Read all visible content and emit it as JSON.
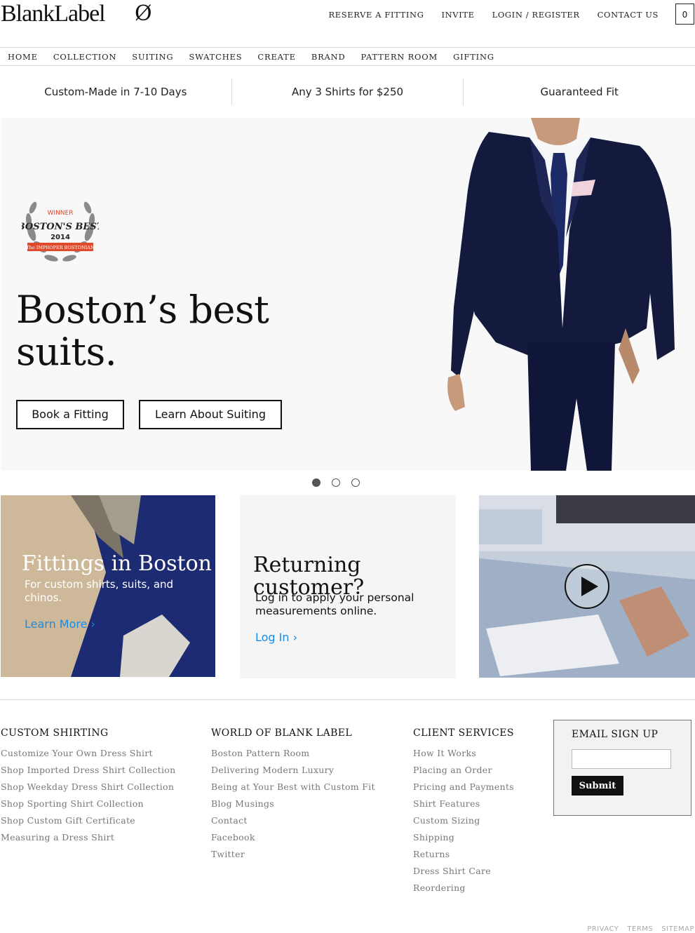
{
  "header": {
    "logo": "BlankLabel",
    "logo_mark": "Ø",
    "topnav": [
      "RESERVE A FITTING",
      "INVITE",
      "LOGIN / REGISTER",
      "CONTACT US"
    ],
    "cart_count": "0"
  },
  "mainnav": [
    "HOME",
    "COLLECTION",
    "SUITING",
    "SWATCHES",
    "CREATE",
    "BRAND",
    "PATTERN ROOM",
    "GIFTING"
  ],
  "props": [
    "Custom-Made in 7-10 Days",
    "Any 3 Shirts for $250",
    "Guaranteed Fit"
  ],
  "hero": {
    "badge": {
      "top": "WINNER",
      "main": "BOSTON'S BEST",
      "year": "2014",
      "ribbon": "The IMPROPER BOSTONIAN"
    },
    "title": "Boston’s best suits.",
    "btn1": "Book a Fitting",
    "btn2": "Learn About Suiting",
    "slides": 3,
    "active_slide": 1
  },
  "tiles": {
    "fittings": {
      "title": "Fittings in Boston",
      "text": "For custom shirts, suits, and chinos.",
      "link": "Learn More ›"
    },
    "returning": {
      "title": "Returning customer?",
      "text": "Log in to apply your personal measurements online.",
      "link": "Log In ›"
    }
  },
  "footer": {
    "col1": {
      "title": "CUSTOM SHIRTING",
      "items": [
        "Customize Your Own Dress Shirt",
        "Shop Imported Dress Shirt Collection",
        "Shop Weekday Dress Shirt Collection",
        "Shop Sporting Shirt Collection",
        "Shop Custom Gift Certificate",
        "Measuring a Dress Shirt"
      ]
    },
    "col2": {
      "title": "WORLD OF BLANK LABEL",
      "items": [
        "Boston Pattern Room",
        "Delivering Modern Luxury",
        "Being at Your Best with Custom Fit",
        "Blog Musings",
        "Contact",
        "Facebook",
        "Twitter"
      ]
    },
    "col3": {
      "title": "CLIENT SERVICES",
      "items": [
        "How It Works",
        "Placing an Order",
        "Pricing and Payments",
        "Shirt Features",
        "Custom Sizing",
        "Shipping",
        "Returns",
        "Dress Shirt Care",
        "Reordering"
      ]
    },
    "signup": {
      "title": "EMAIL SIGN UP",
      "button": "Submit"
    },
    "legal": [
      "PRIVACY",
      "TERMS",
      "SITEMAP"
    ]
  }
}
